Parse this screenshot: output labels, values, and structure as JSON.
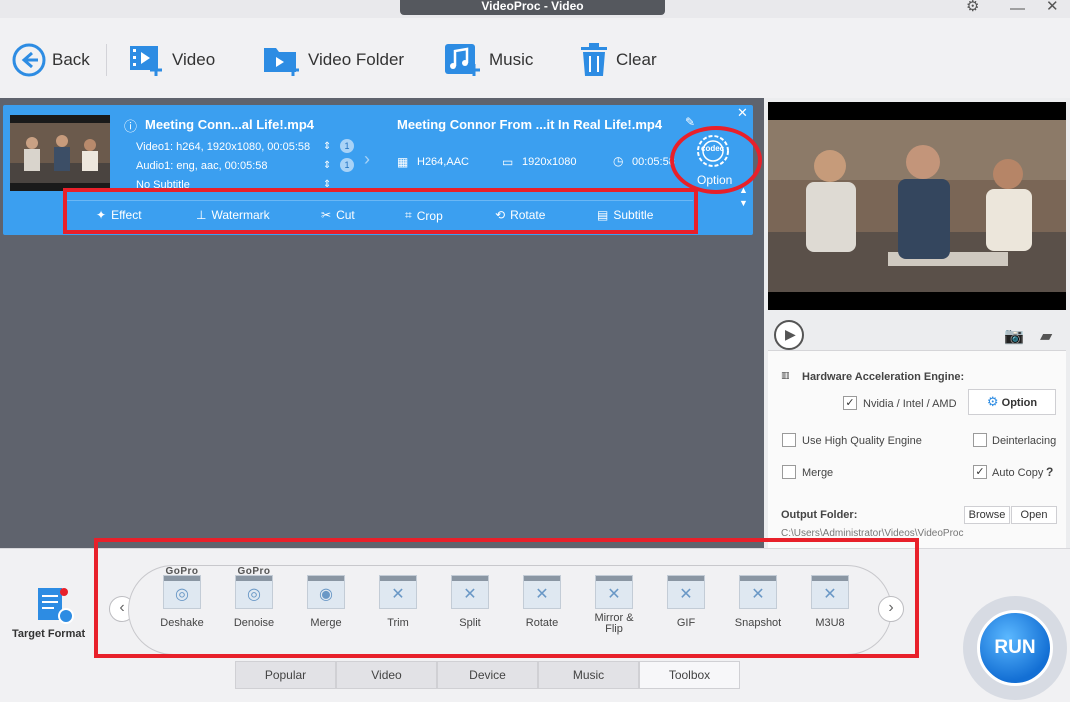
{
  "window": {
    "title": "VideoProc - Video"
  },
  "toolbar": {
    "back": "Back",
    "video": "Video",
    "video_folder": "Video Folder",
    "music": "Music",
    "clear": "Clear"
  },
  "file": {
    "source_name": "Meeting Conn...al Life!.mp4",
    "video_track": "Video1: h264, 1920x1080, 00:05:58",
    "audio_track": "Audio1: eng, aac, 00:05:58",
    "subtitle_track": "No Subtitle",
    "video_count": "1",
    "audio_count": "1",
    "output_name": "Meeting Connor From ...it In Real Life!.mp4",
    "output_codec": "H264,AAC",
    "output_resolution": "1920x1080",
    "output_duration": "00:05:58",
    "codec_label": "codec",
    "option_label": "Option"
  },
  "edit_tools": [
    "Effect",
    "Watermark",
    "Cut",
    "Crop",
    "Rotate",
    "Subtitle"
  ],
  "settings": {
    "hw_title": "Hardware Acceleration Engine:",
    "hw_checkbox": "Nvidia / Intel / AMD",
    "option_button": "Option",
    "high_quality": "Use High Quality Engine",
    "deinterlacing": "Deinterlacing",
    "merge": "Merge",
    "auto_copy": "Auto Copy",
    "help": "?",
    "output_folder_label": "Output Folder:",
    "output_path": "C:\\Users\\Administrator\\Videos\\VideoProc",
    "browse": "Browse",
    "open": "Open"
  },
  "target_format": "Target Format",
  "toolbox": [
    {
      "label": "Deshake",
      "brand": "GoPro"
    },
    {
      "label": "Denoise",
      "brand": "GoPro"
    },
    {
      "label": "Merge",
      "brand": ""
    },
    {
      "label": "Trim",
      "brand": ""
    },
    {
      "label": "Split",
      "brand": ""
    },
    {
      "label": "Rotate",
      "brand": ""
    },
    {
      "label": "Mirror &\nFlip",
      "brand": ""
    },
    {
      "label": "GIF",
      "brand": ""
    },
    {
      "label": "Snapshot",
      "brand": ""
    },
    {
      "label": "M3U8",
      "brand": ""
    }
  ],
  "tabs": [
    "Popular",
    "Video",
    "Device",
    "Music",
    "Toolbox"
  ],
  "active_tab": "Toolbox",
  "run": "RUN",
  "colors": {
    "accent": "#3b9ff0",
    "annotation": "#e8202a",
    "panel": "#5f636d"
  }
}
